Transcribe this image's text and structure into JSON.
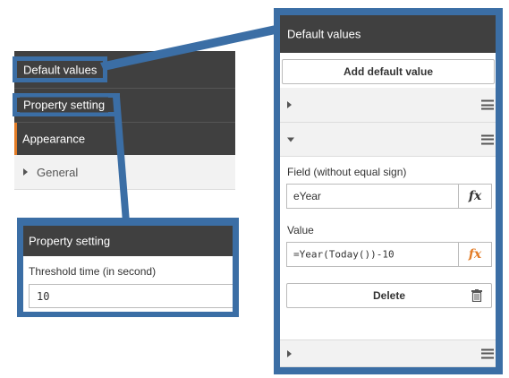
{
  "left_panel": {
    "default_values_label": "Default values",
    "property_setting_label": "Property setting",
    "appearance_label": "Appearance",
    "general_label": "General"
  },
  "zoom_property": {
    "header": "Property setting",
    "threshold_label": "Threshold time (in second)",
    "threshold_value": "10"
  },
  "zoom_default_values": {
    "header": "Default values",
    "add_button_label": "Add default value",
    "field_label": "Field (without equal sign)",
    "field_value": "eYear",
    "value_label": "Value",
    "value_value": "=Year(Today())-10",
    "delete_button_label": "Delete",
    "fx_symbol": "fx"
  },
  "colors": {
    "callout_blue": "#3b6ea5",
    "header_dark": "#404040",
    "accent_orange": "#e37c26"
  }
}
